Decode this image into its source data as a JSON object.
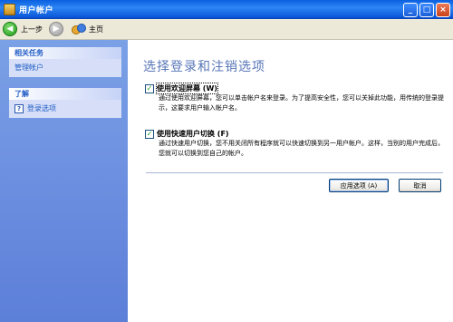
{
  "window": {
    "title": "用户帐户"
  },
  "toolbar": {
    "back_label": "上一步",
    "home_label": "主页"
  },
  "sidebar": {
    "related_tasks": {
      "title": "相关任务",
      "items": [
        {
          "label": "管理帐户"
        }
      ]
    },
    "learn": {
      "title": "了解",
      "items": [
        {
          "label": "登录选项",
          "icon": "help-icon"
        }
      ]
    }
  },
  "main": {
    "heading": "选择登录和注销选项",
    "options": [
      {
        "label": "使用欢迎屏幕 (W)",
        "checked": true,
        "description": "通过使用欢迎屏幕，您可以单击帐户名来登录。为了提高安全性，您可以关掉此功能，用传统的登录提示，这要求用户输入帐户名。"
      },
      {
        "label": "使用快速用户切换 (F)",
        "checked": true,
        "description": "通过快速用户切换，您不用关闭所有程序就可以快速切换到另一用户帐户。这样，当别的用户完成后，您就可以切换到您自己的帐户。"
      }
    ],
    "buttons": {
      "apply": "应用选项 (A)",
      "cancel": "取消"
    }
  },
  "colors": {
    "titlebar": "#0a5fe0",
    "sidebar": "#6d8fe0",
    "heading": "#5876b8",
    "link": "#215dc6"
  }
}
